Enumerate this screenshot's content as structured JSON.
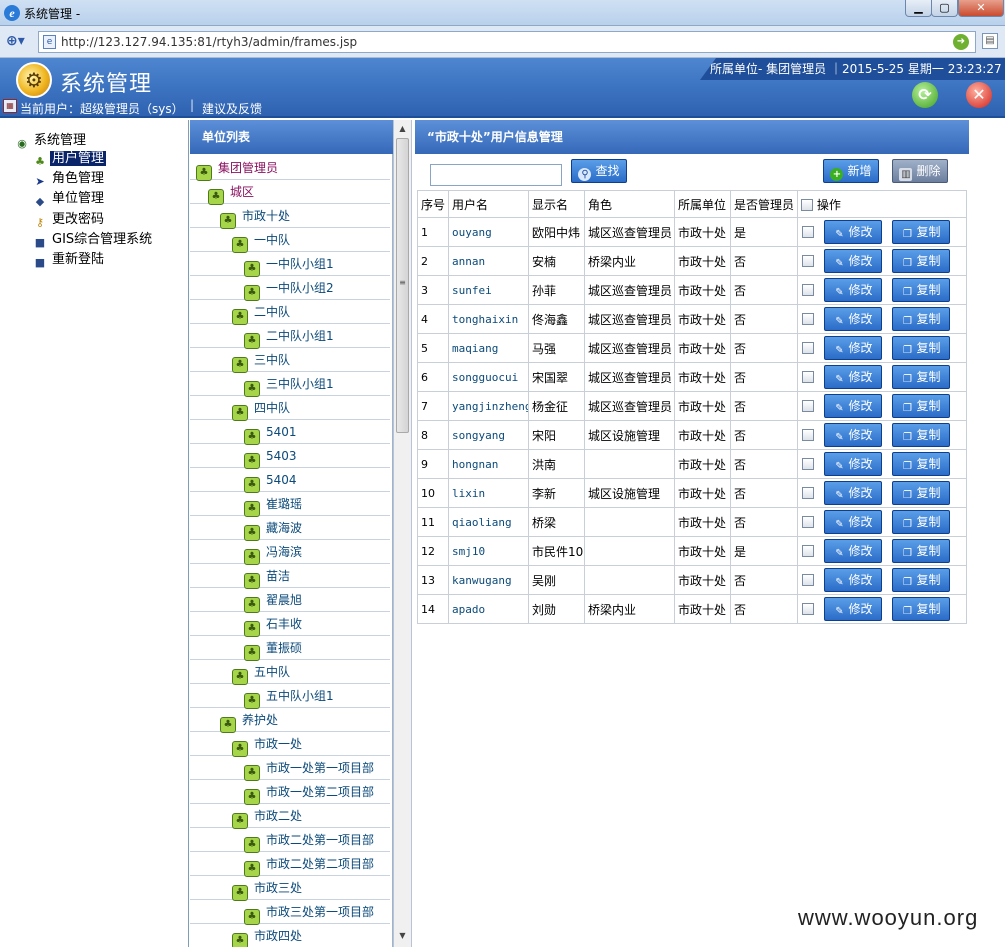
{
  "window": {
    "title": "系统管理 -",
    "min": "▁",
    "max": "▢",
    "close": "✕"
  },
  "address": {
    "url": "http://123.127.94.135:81/rtyh3/admin/frames.jsp"
  },
  "header": {
    "title": "系统管理",
    "user": "当前用户：超级管理员（sys）",
    "separator": "|",
    "feedback": "建议及反馈",
    "unit_info": "所属单位- 集团管理员 ｜2015-5-25 星期一 23:23:27"
  },
  "nav": {
    "items": [
      {
        "label": "系统管理",
        "icon": "globe-icon"
      },
      {
        "label": "用户管理",
        "icon": "users-icon",
        "selected": true
      },
      {
        "label": "角色管理",
        "icon": "arrow-icon"
      },
      {
        "label": "单位管理",
        "icon": "book-icon"
      },
      {
        "label": "更改密码",
        "icon": "key-icon"
      },
      {
        "label": "GIS综合管理系统",
        "icon": "cube-icon"
      },
      {
        "label": "重新登陆",
        "icon": "cube-icon"
      }
    ]
  },
  "tree": {
    "title": "单位列表",
    "nodes": [
      {
        "label": "集团管理员",
        "level": 0
      },
      {
        "label": "城区",
        "level": 1
      },
      {
        "label": "市政十处",
        "level": 2
      },
      {
        "label": "一中队",
        "level": 3
      },
      {
        "label": "一中队小组1",
        "level": 4
      },
      {
        "label": "一中队小组2",
        "level": 4
      },
      {
        "label": "二中队",
        "level": 3
      },
      {
        "label": "二中队小组1",
        "level": 4
      },
      {
        "label": "三中队",
        "level": 3
      },
      {
        "label": "三中队小组1",
        "level": 4
      },
      {
        "label": "四中队",
        "level": 3
      },
      {
        "label": "5401",
        "level": 4
      },
      {
        "label": "5403",
        "level": 4
      },
      {
        "label": "5404",
        "level": 4
      },
      {
        "label": "崔璐瑶",
        "level": 4
      },
      {
        "label": "藏海波",
        "level": 4
      },
      {
        "label": "冯海滨",
        "level": 4
      },
      {
        "label": "苗洁",
        "level": 4
      },
      {
        "label": "翟晨旭",
        "level": 4
      },
      {
        "label": "石丰收",
        "level": 4
      },
      {
        "label": "董振硕",
        "level": 4
      },
      {
        "label": "五中队",
        "level": 3
      },
      {
        "label": "五中队小组1",
        "level": 4
      },
      {
        "label": "养护处",
        "level": 2
      },
      {
        "label": "市政一处",
        "level": 3
      },
      {
        "label": "市政一处第一项目部",
        "level": 4
      },
      {
        "label": "市政一处第二项目部",
        "level": 4
      },
      {
        "label": "市政二处",
        "level": 3
      },
      {
        "label": "市政二处第一项目部",
        "level": 4
      },
      {
        "label": "市政二处第二项目部",
        "level": 4
      },
      {
        "label": "市政三处",
        "level": 3
      },
      {
        "label": "市政三处第一项目部",
        "level": 4
      },
      {
        "label": "市政四处",
        "level": 3
      }
    ]
  },
  "main": {
    "title": "“市政十处”用户信息管理",
    "search_button": "查找",
    "add_button": "新增",
    "delete_button": "删除",
    "columns": [
      "序号",
      "用户名",
      "显示名",
      "角色",
      "所属单位",
      "是否管理员",
      "操作"
    ],
    "edit_label": "修改",
    "copy_label": "复制",
    "rows": [
      {
        "no": "1",
        "username": "ouyang",
        "display": "欧阳中炜",
        "role": "城区巡查管理员",
        "unit": "市政十处",
        "admin": "是"
      },
      {
        "no": "2",
        "username": "annan",
        "display": "安楠",
        "role": "桥梁内业",
        "unit": "市政十处",
        "admin": "否"
      },
      {
        "no": "3",
        "username": "sunfei",
        "display": "孙菲",
        "role": "城区巡查管理员",
        "unit": "市政十处",
        "admin": "否"
      },
      {
        "no": "4",
        "username": "tonghaixin",
        "display": "佟海鑫",
        "role": "城区巡查管理员",
        "unit": "市政十处",
        "admin": "否"
      },
      {
        "no": "5",
        "username": "maqiang",
        "display": "马强",
        "role": "城区巡查管理员",
        "unit": "市政十处",
        "admin": "否"
      },
      {
        "no": "6",
        "username": "songguocui",
        "display": "宋国翠",
        "role": "城区巡查管理员",
        "unit": "市政十处",
        "admin": "否"
      },
      {
        "no": "7",
        "username": "yangjinzheng",
        "display": "杨金征",
        "role": "城区巡查管理员",
        "unit": "市政十处",
        "admin": "否"
      },
      {
        "no": "8",
        "username": "songyang",
        "display": "宋阳",
        "role": "城区设施管理",
        "unit": "市政十处",
        "admin": "否"
      },
      {
        "no": "9",
        "username": "hongnan",
        "display": "洪南",
        "role": "",
        "unit": "市政十处",
        "admin": "否"
      },
      {
        "no": "10",
        "username": "lixin",
        "display": "李新",
        "role": "城区设施管理",
        "unit": "市政十处",
        "admin": "否"
      },
      {
        "no": "11",
        "username": "qiaoliang",
        "display": "桥梁",
        "role": "",
        "unit": "市政十处",
        "admin": "否"
      },
      {
        "no": "12",
        "username": "smj10",
        "display": "市民件10",
        "role": "",
        "unit": "市政十处",
        "admin": "是"
      },
      {
        "no": "13",
        "username": "kanwugang",
        "display": "吴刚",
        "role": "",
        "unit": "市政十处",
        "admin": "否"
      },
      {
        "no": "14",
        "username": "apado",
        "display": "刘勋",
        "role": "桥梁内业",
        "unit": "市政十处",
        "admin": "否"
      }
    ]
  },
  "watermark": "www.wooyun.org"
}
